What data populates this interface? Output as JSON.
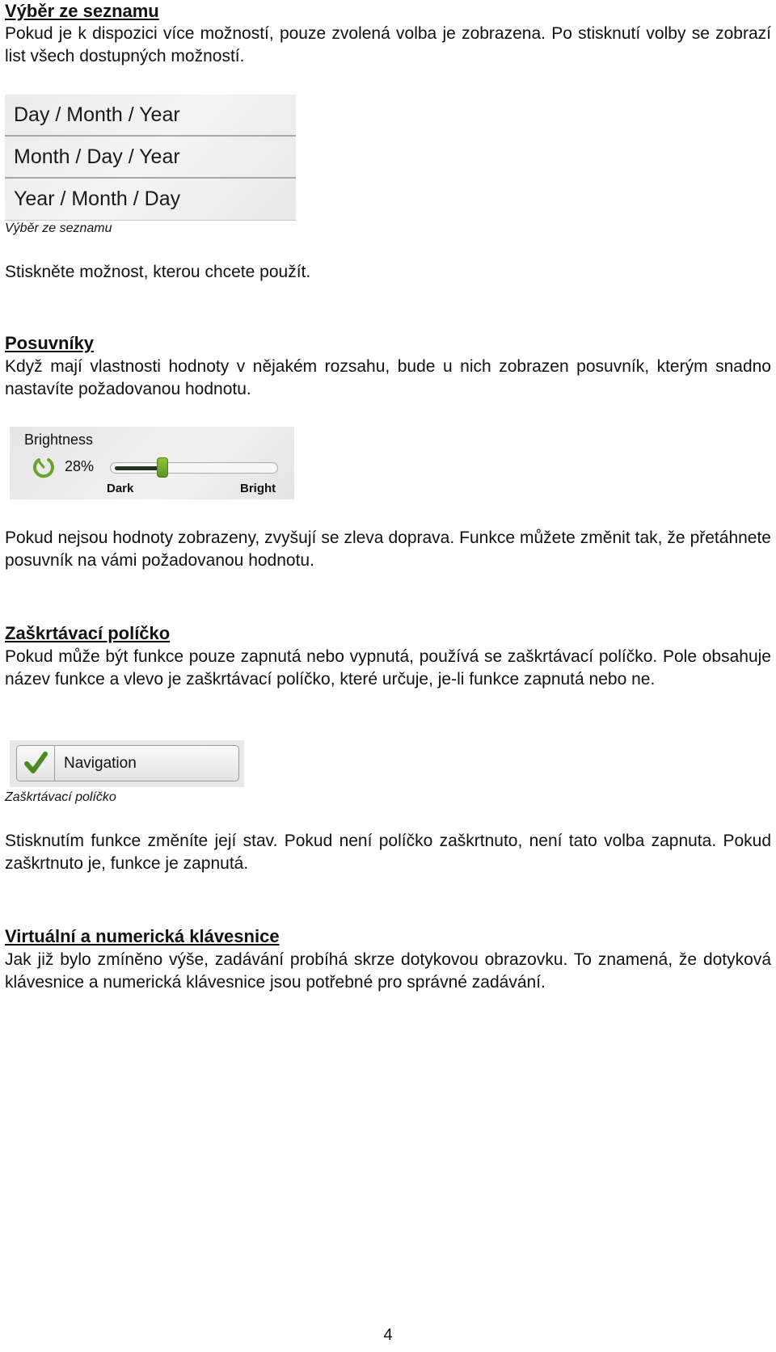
{
  "sections": {
    "list": {
      "heading": "Výběr ze seznamu",
      "body": "Pokud je k dispozici více možností, pouze zvolená volba je zobrazena. Po stisknutí volby se zobrazí list všech dostupných možností.",
      "options": [
        "Day / Month / Year",
        "Month / Day / Year",
        "Year / Month / Day"
      ],
      "caption": "Výběr ze seznamu",
      "after": "Stiskněte možnost, kterou chcete použít."
    },
    "slider": {
      "heading": "Posuvníky",
      "body": "Když mají vlastnosti hodnoty v nějakém rozsahu, bude u nich zobrazen posuvník, kterým snadno nastavíte požadovanou hodnotu.",
      "title": "Brightness",
      "value_label": "28%",
      "value_fraction": 0.28,
      "min_label": "Dark",
      "max_label": "Bright",
      "accent": "#6aa22a",
      "after": "Pokud nejsou hodnoty zobrazeny, zvyšují se zleva doprava. Funkce můžete změnit tak, že přetáhnete posuvník na vámi požadovanou hodnotu."
    },
    "checkbox": {
      "heading": "Zaškrtávací políčko",
      "body": "Pokud může být funkce pouze zapnutá nebo vypnutá, používá se zaškrtávací políčko. Pole obsahuje název funkce a vlevo je zaškrtávací políčko, které určuje, je-li funkce zapnutá nebo ne.",
      "label": "Navigation",
      "checked": true,
      "caption": "Zaškrtávací políčko",
      "after": "Stisknutím funkce změníte její stav.  Pokud není políčko zaškrtnuto, není tato volba zapnuta. Pokud zaškrtnuto je, funkce je zapnutá."
    },
    "keyboard": {
      "heading": "Virtuální a numerická klávesnice",
      "body": "Jak již bylo zmíněno výše, zadávání probíhá skrze dotykovou obrazovku. To znamená, že dotyková klávesnice a numerická klávesnice jsou potřebné pro správné zadávání."
    }
  },
  "page_number": "4"
}
